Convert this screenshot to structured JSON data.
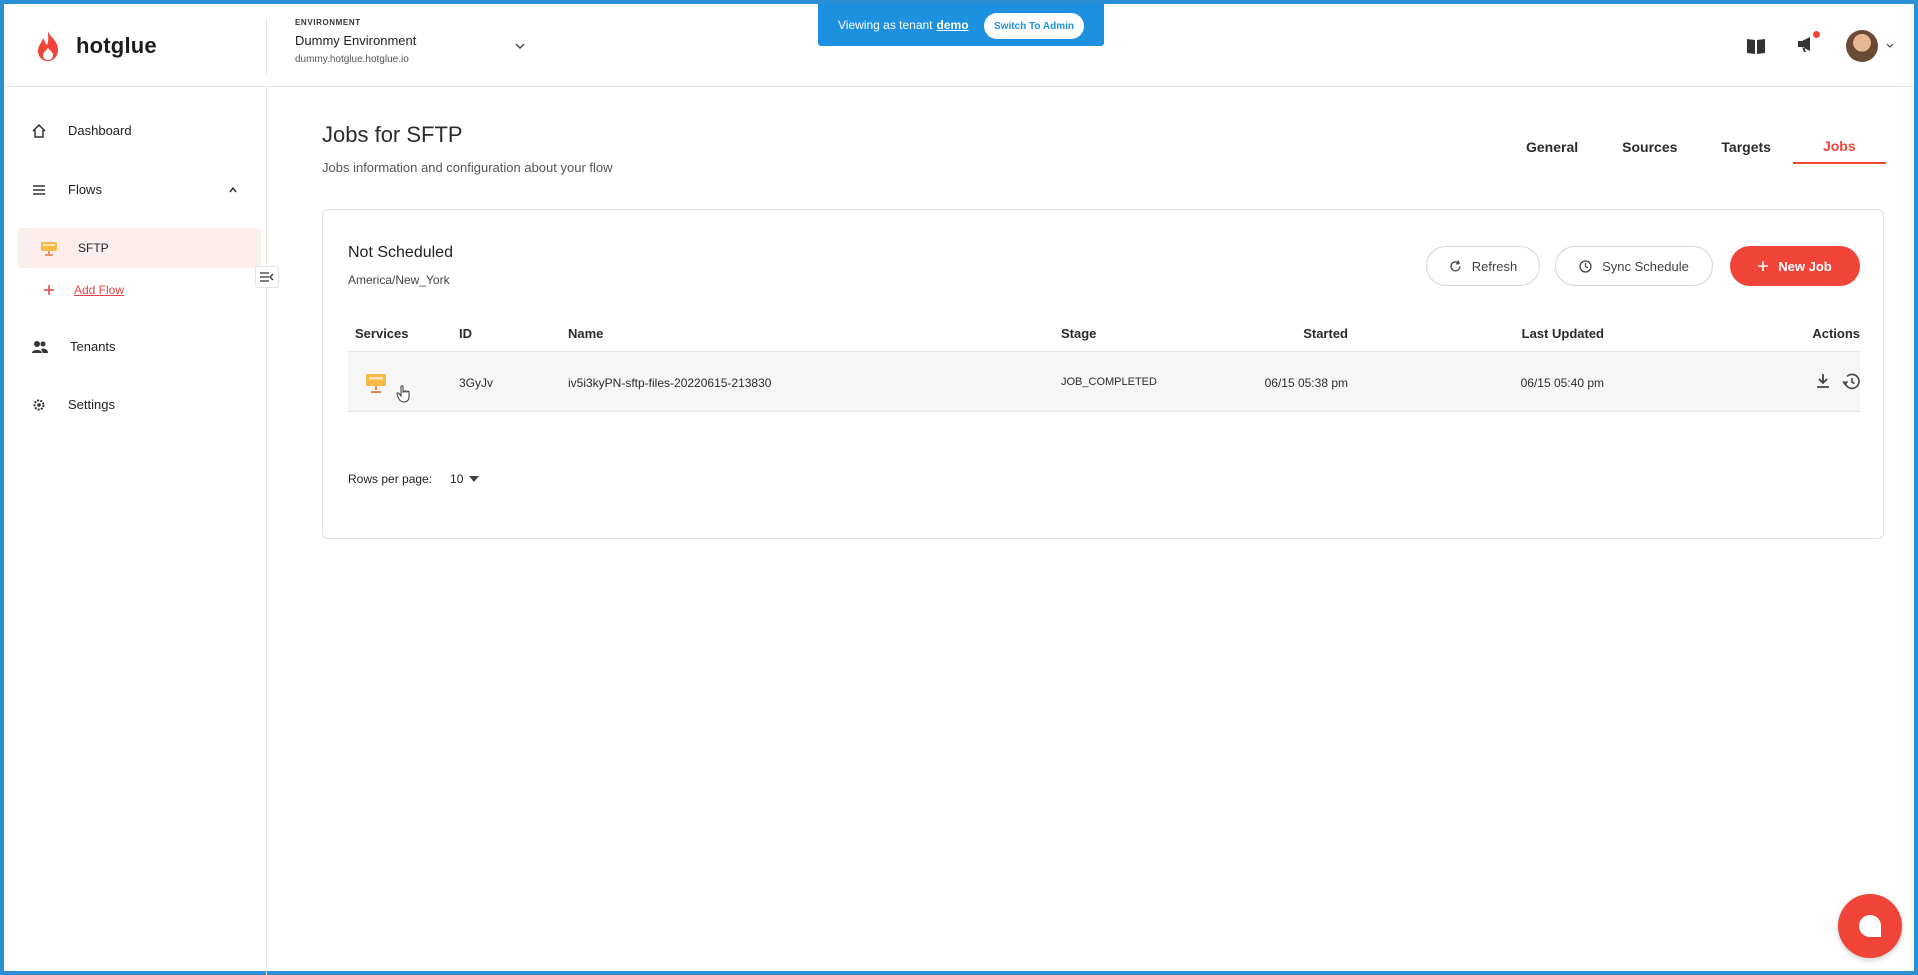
{
  "app": {
    "name": "hotglue"
  },
  "environment": {
    "label": "ENVIRONMENT",
    "name": "Dummy Environment",
    "url": "dummy.hotglue.hotglue.io"
  },
  "tenant_banner": {
    "text": "Viewing as tenant",
    "tenant": "demo",
    "switch_label": "Switch To Admin"
  },
  "sidebar": {
    "items": [
      {
        "label": "Dashboard",
        "icon": "home-icon"
      },
      {
        "label": "Flows",
        "icon": "flows-icon"
      },
      {
        "label": "Tenants",
        "icon": "users-icon"
      },
      {
        "label": "Settings",
        "icon": "gear-icon"
      }
    ],
    "flow_sub": {
      "label": "SFTP",
      "icon": "sftp-icon"
    },
    "add_flow": "Add Flow"
  },
  "page": {
    "title": "Jobs for SFTP",
    "subtitle": "Jobs information and configuration about your flow"
  },
  "tabs": [
    {
      "label": "General"
    },
    {
      "label": "Sources"
    },
    {
      "label": "Targets"
    },
    {
      "label": "Jobs",
      "active": true
    }
  ],
  "schedule": {
    "status": "Not Scheduled",
    "timezone": "America/New_York"
  },
  "buttons": {
    "refresh": "Refresh",
    "sync_schedule": "Sync Schedule",
    "new_job": "New Job"
  },
  "table": {
    "headers": {
      "services": "Services",
      "id": "ID",
      "name": "Name",
      "stage": "Stage",
      "started": "Started",
      "last_updated": "Last Updated",
      "actions": "Actions"
    },
    "rows": [
      {
        "id": "3GyJv",
        "name": "iv5i3kyPN-sftp-files-20220615-213830",
        "stage": "JOB_COMPLETED",
        "started": "06/15 05:38 pm",
        "last_updated": "06/15 05:40 pm"
      }
    ]
  },
  "pagination": {
    "label": "Rows per page:",
    "value": "10"
  },
  "colors": {
    "accent": "#f04438",
    "banner": "#1e90e0",
    "border": "#2b8fd6"
  }
}
